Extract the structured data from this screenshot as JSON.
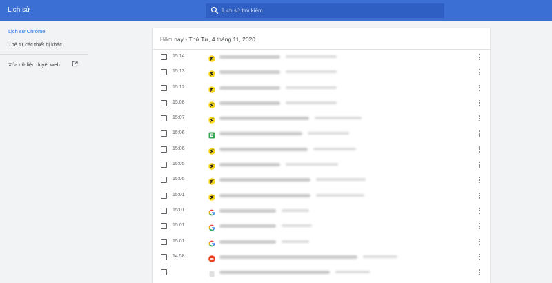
{
  "app_title": "Lịch sử",
  "search": {
    "placeholder": "Lịch sử tìm kiếm"
  },
  "sidebar": {
    "items": [
      {
        "label": "Lịch sử Chrome",
        "active": true
      },
      {
        "label": "Thẻ từ các thiết bị khác",
        "active": false
      },
      {
        "label": "Xóa dữ liệu duyệt web",
        "active": false
      }
    ]
  },
  "history": {
    "date_header": "Hôm nay - Thứ Tư, 4 tháng 11, 2020",
    "rows": [
      {
        "time": "15:14",
        "favicon": "yellow-runner-icon"
      },
      {
        "time": "15:13",
        "favicon": "yellow-runner-icon"
      },
      {
        "time": "15:12",
        "favicon": "yellow-runner-icon"
      },
      {
        "time": "15:08",
        "favicon": "yellow-runner-icon"
      },
      {
        "time": "15:07",
        "favicon": "yellow-runner-icon"
      },
      {
        "time": "15:06",
        "favicon": "green-doc-icon"
      },
      {
        "time": "15:06",
        "favicon": "yellow-runner-icon"
      },
      {
        "time": "15:05",
        "favicon": "yellow-runner-icon"
      },
      {
        "time": "15:05",
        "favicon": "yellow-runner-icon"
      },
      {
        "time": "15:01",
        "favicon": "yellow-runner-icon"
      },
      {
        "time": "15:01",
        "favicon": "google-g-icon"
      },
      {
        "time": "15:01",
        "favicon": "google-g-icon"
      },
      {
        "time": "15:01",
        "favicon": "google-g-icon"
      },
      {
        "time": "14:58",
        "favicon": "red-circle-icon"
      },
      {
        "time": "",
        "favicon": "generic-page-icon"
      }
    ]
  },
  "colors": {
    "header": "#3b6fd4",
    "accent": "#1a73e8",
    "background": "#f1f3f4"
  }
}
